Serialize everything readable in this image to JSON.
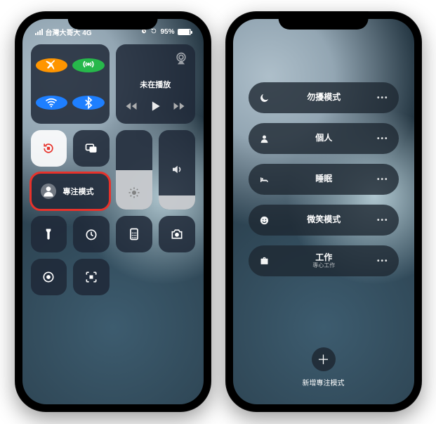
{
  "status": {
    "carrier": "台灣大哥大 4G",
    "battery_pct": "95%",
    "battery_fill": "95%",
    "alarm_icon": "alarm-icon"
  },
  "cc": {
    "media_title": "未在播放",
    "focus_label": "專注模式",
    "brightness_pct": "50%",
    "volume_pct": "18%"
  },
  "focus": {
    "items": [
      {
        "icon": "moon",
        "label": "勿擾模式",
        "sub": ""
      },
      {
        "icon": "person",
        "label": "個人",
        "sub": ""
      },
      {
        "icon": "bed",
        "label": "睡眠",
        "sub": ""
      },
      {
        "icon": "smile",
        "label": "微笑模式",
        "sub": ""
      },
      {
        "icon": "briefcase",
        "label": "工作",
        "sub": "專心工作"
      }
    ],
    "add_label": "新增專注模式"
  },
  "colors": {
    "airplane": "#ff9500",
    "antenna": "#27b84b",
    "wifi": "#1e7fff",
    "bluetooth": "#1e7fff",
    "lock": "#e7322b"
  }
}
